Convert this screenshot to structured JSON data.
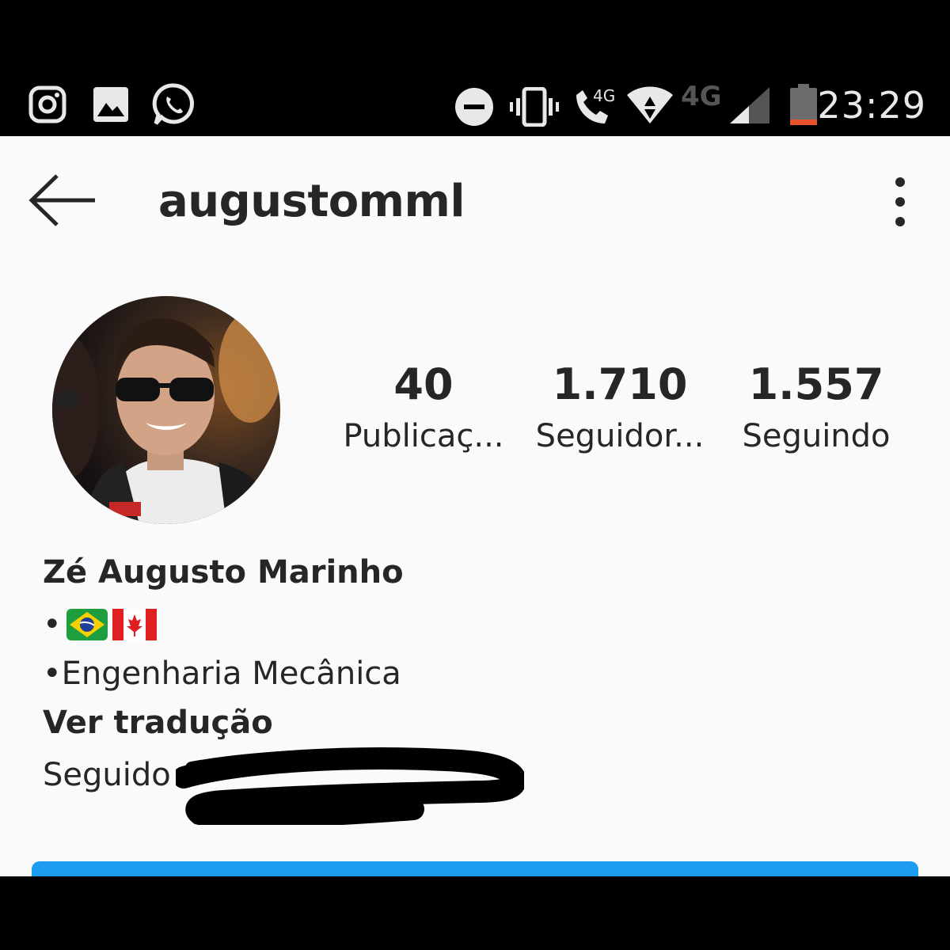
{
  "status_bar": {
    "left_icons": [
      "instagram-icon",
      "gallery-icon",
      "whatsapp-icon"
    ],
    "right_icons": [
      "do-not-disturb-icon",
      "vibrate-icon",
      "volte-call-icon",
      "wifi-icon",
      "signal-icon",
      "battery-icon"
    ],
    "volte_label": "4G",
    "network_label": "4G",
    "time": "23:29",
    "battery_level": 0.15
  },
  "header": {
    "username": "augustomml"
  },
  "stats": [
    {
      "value": "40",
      "label": "Publicaç..."
    },
    {
      "value": "1.710",
      "label": "Seguidor..."
    },
    {
      "value": "1.557",
      "label": "Seguindo"
    }
  ],
  "bio": {
    "name": "Zé Augusto Marinho",
    "flags_prefix": "•",
    "flags": [
      "brazil-flag",
      "canada-flag"
    ],
    "course": "•Engenharia Mecânica",
    "translate": "Ver tradução",
    "followed_by": "Seguido"
  },
  "colors": {
    "background": "#fafafa",
    "text": "#262626",
    "accent": "#1d9bf0",
    "battery_low": "#e8532e"
  }
}
